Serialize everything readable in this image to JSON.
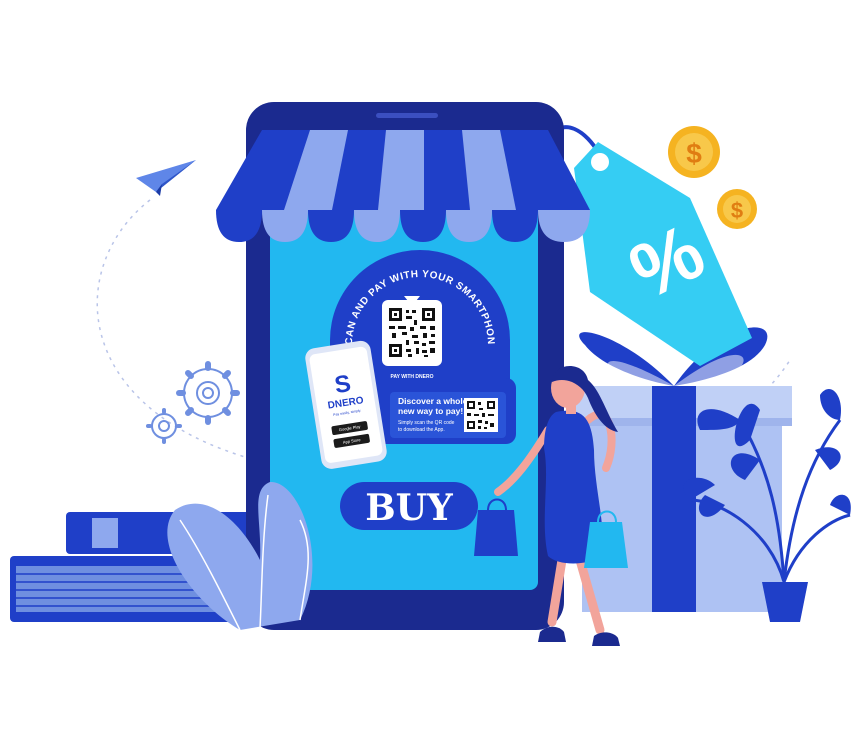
{
  "illustration": {
    "buy_label": "BUY",
    "sign_arc_text": "SCAN AND PAY WITH YOUR SMARTPHONE",
    "pay_with_label": "PAY WITH DNERO",
    "discover_line1": "Discover a whole",
    "discover_line2": "new way to pay!",
    "scan_line1": "Simply scan the QR code",
    "scan_line2": "to download the App.",
    "brand_name": "DNERO",
    "brand_tagline": "Pay easily, simply.",
    "store_badge_1": "Google Play",
    "store_badge_2": "App Store",
    "coin_symbol": "$",
    "tag_symbol": "%"
  },
  "colors": {
    "navy": "#1b2a8f",
    "royal": "#1f3fc8",
    "light_blue": "#8ea8ee",
    "cyan": "#22b8f0",
    "sky": "#42c8f4",
    "gift": "#aec2f3",
    "coin": "#f5b321",
    "skin": "#f2a49b"
  },
  "icons": [
    "paper-plane-icon",
    "gear-icon",
    "qr-code-icon",
    "coin-icon",
    "price-tag-icon",
    "gift-box-icon",
    "plant-icon",
    "shopping-bag-icon",
    "book-icon",
    "leaf-icon"
  ]
}
